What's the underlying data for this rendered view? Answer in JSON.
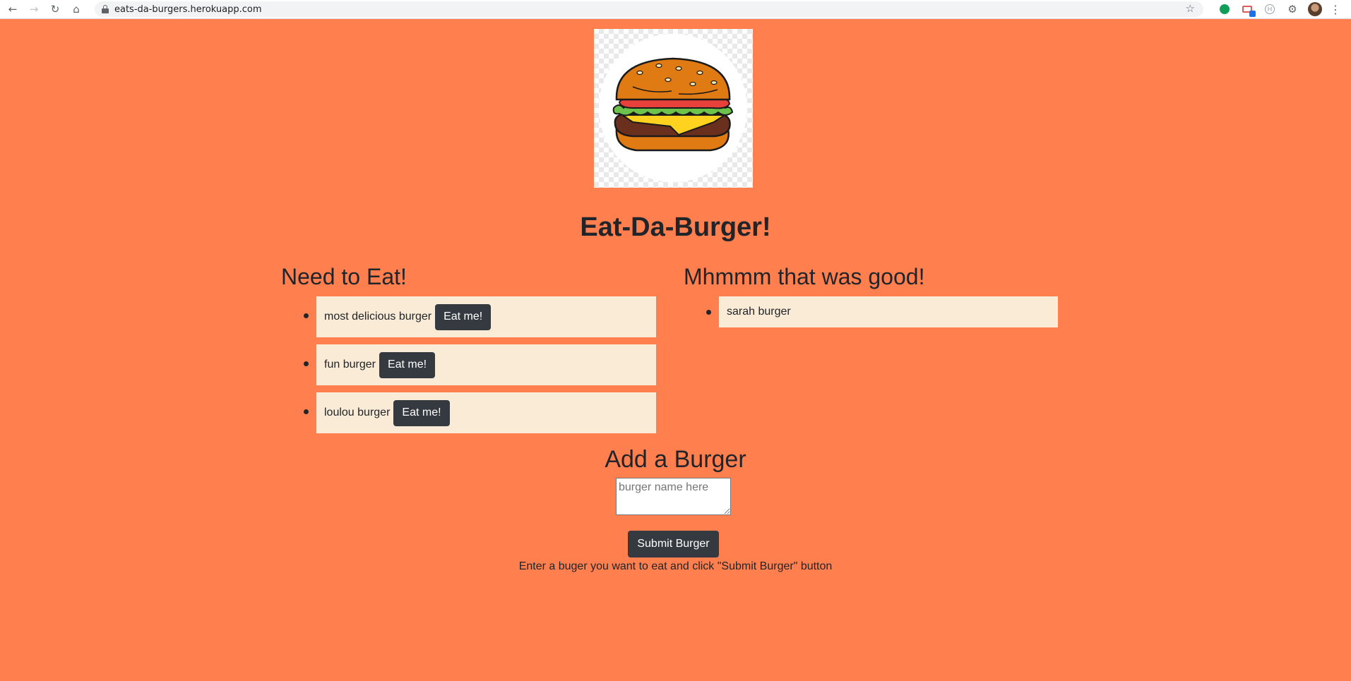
{
  "browser": {
    "url": "eats-da-burgers.herokuapp.com",
    "back_icon": "arrow-left",
    "forward_icon": "arrow-right",
    "reload_icon": "reload",
    "home_icon": "home",
    "star_icon": "star",
    "ext_badge": "1"
  },
  "page": {
    "title": "Eat-Da-Burger!",
    "logo_icon": "burger-icon",
    "background_color": "#ff7f4f",
    "item_background": "#faebd7",
    "button_color": "#343a40"
  },
  "to_eat": {
    "heading": "Need to Eat!",
    "items": [
      {
        "name": "most delicious burger",
        "button": "Eat me!"
      },
      {
        "name": "fun burger",
        "button": "Eat me!"
      },
      {
        "name": "loulou burger",
        "button": "Eat me!"
      }
    ]
  },
  "eaten": {
    "heading": "Mhmmm that was good!",
    "items": [
      {
        "name": "sarah burger"
      }
    ]
  },
  "add": {
    "heading": "Add a Burger",
    "placeholder": "burger name here",
    "value": "",
    "submit_label": "Submit Burger",
    "hint": "Enter a buger you want to eat and click \"Submit Burger\" button"
  }
}
